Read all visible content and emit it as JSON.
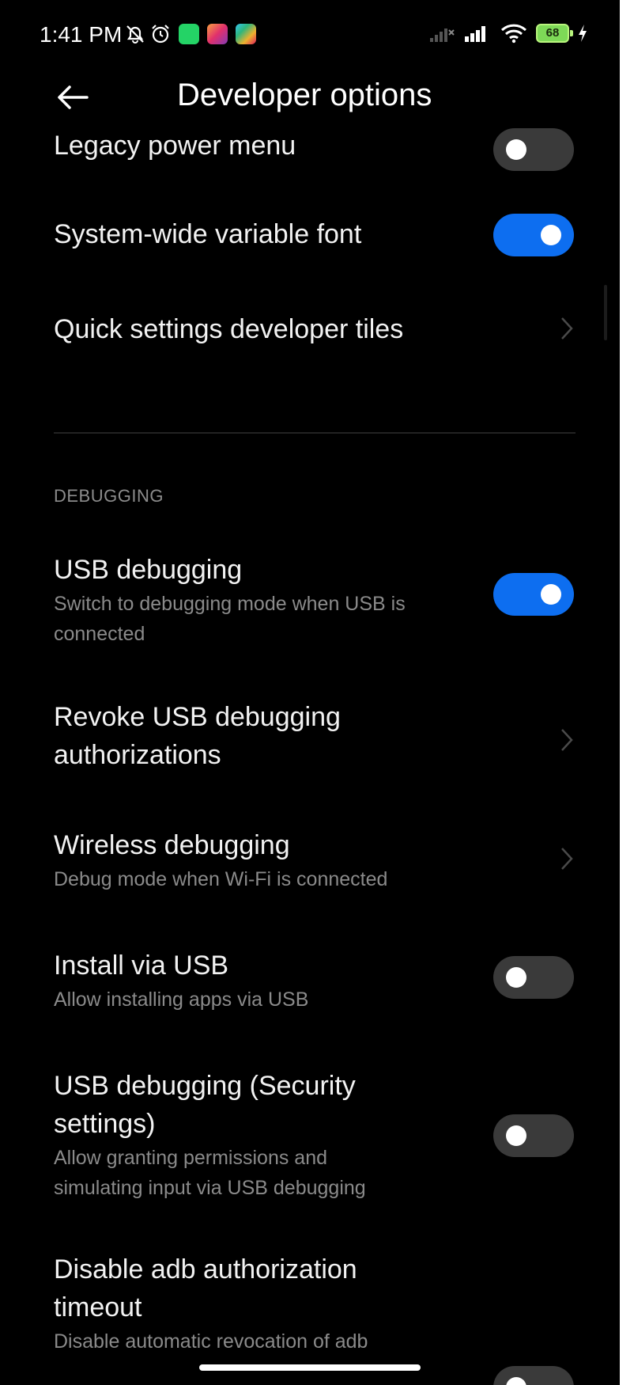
{
  "status_bar": {
    "time": "1:41 PM",
    "battery": "68",
    "icons": [
      "mute-icon",
      "alarm-icon",
      "app-green-icon",
      "instagram-icon",
      "app-colorful-icon",
      "signal-icon",
      "signal-icon",
      "wifi-icon",
      "battery-icon",
      "charging-icon"
    ]
  },
  "header": {
    "title": "Developer options"
  },
  "items": [
    {
      "title": "Legacy power menu",
      "control": "toggle",
      "on": false
    },
    {
      "title": "System-wide variable font",
      "control": "toggle",
      "on": true
    },
    {
      "title": "Quick settings developer tiles",
      "control": "chevron"
    }
  ],
  "debugging": {
    "section_label": "DEBUGGING",
    "items": [
      {
        "title": "USB debugging",
        "subtitle_line1": "Switch to debugging mode when USB is",
        "subtitle_line2": "connected",
        "control": "toggle",
        "on": true
      },
      {
        "title_line1": "Revoke USB debugging",
        "title_line2": "authorizations",
        "control": "chevron"
      },
      {
        "title": "Wireless debugging",
        "subtitle": "Debug mode when Wi-Fi is connected",
        "control": "chevron"
      },
      {
        "title": "Install via USB",
        "subtitle": "Allow installing apps via USB",
        "control": "toggle",
        "on": false
      },
      {
        "title_line1": "USB debugging (Security",
        "title_line2": "settings)",
        "subtitle_line1": "Allow granting permissions and",
        "subtitle_line2": "simulating input via USB debugging",
        "control": "toggle",
        "on": false
      },
      {
        "title_line1": "Disable adb authorization",
        "title_line2": "timeout",
        "subtitle_line1": "Disable automatic revocation of adb",
        "control": "toggle",
        "on": false
      }
    ]
  },
  "colors": {
    "background": "#000000",
    "accent": "#0d6ef0",
    "toggle_off": "#3a3a3a",
    "subtitle": "#8a8a8a"
  }
}
